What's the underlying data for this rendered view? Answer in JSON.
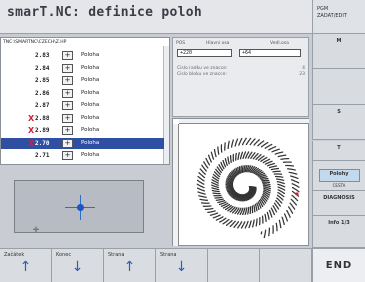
{
  "title": "smarT.NC: definice poloh",
  "mode": {
    "line1": "PGM",
    "line2": "ZADAT/EDIT"
  },
  "tree": {
    "path": "TNC:\\SMARTNC\\CZECH\\Z.HP",
    "rows": [
      {
        "mark": "",
        "num": "2.83",
        "label": "Poloha"
      },
      {
        "mark": "",
        "num": "2.84",
        "label": "Poloha"
      },
      {
        "mark": "",
        "num": "2.85",
        "label": "Poloha"
      },
      {
        "mark": "",
        "num": "2.86",
        "label": "Poloha"
      },
      {
        "mark": "",
        "num": "2.87",
        "label": "Poloha"
      },
      {
        "mark": "X",
        "num": "2.88",
        "label": "Poloha"
      },
      {
        "mark": "X",
        "num": "2.89",
        "label": "Poloha"
      },
      {
        "mark": "X",
        "num": "2.70",
        "label": "Poloha",
        "selected": true
      },
      {
        "mark": "",
        "num": "2.71",
        "label": "Poloha"
      }
    ]
  },
  "form": {
    "col1": "POS",
    "col2": "Hlavni osa",
    "col3": "Vedl.osa",
    "field1": "+220",
    "field2": "+64",
    "row1_label": "Cislo radku ve znacce:",
    "row1_value": "4",
    "row2_label": "Cislo bloku ve znacce:",
    "row2_value": "23"
  },
  "right_keys": [
    {
      "label": "M"
    },
    {
      "label": ""
    },
    {
      "label": "S"
    },
    {
      "label": "T"
    },
    {
      "label": "Polohy",
      "sub": "CESTA"
    },
    {
      "label": "DIAGNOSIS"
    },
    {
      "label": "Info 1/3"
    }
  ],
  "bottom_keys": [
    {
      "label": "Začátek",
      "arrow": "↑"
    },
    {
      "label": "Konec",
      "arrow": "↓"
    },
    {
      "label": "Strana",
      "arrow": "↑"
    },
    {
      "label": "Strana",
      "arrow": "↓"
    },
    {
      "label": "",
      "arrow": ""
    },
    {
      "label": "",
      "arrow": ""
    }
  ],
  "end_key": "END"
}
